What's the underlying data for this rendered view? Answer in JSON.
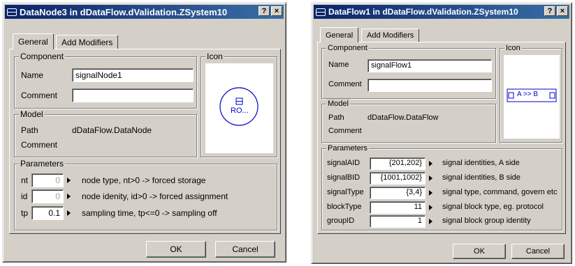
{
  "left": {
    "title": "DataNode3 in dDataFlow.dValidation.ZSystem10",
    "tabs": [
      "General",
      "Add Modifiers"
    ],
    "component": {
      "legend": "Component",
      "name_label": "Name",
      "name_value": "signalNode1",
      "comment_label": "Comment",
      "comment_value": ""
    },
    "icon": {
      "legend": "Icon",
      "text": "RO..."
    },
    "model": {
      "legend": "Model",
      "path_label": "Path",
      "path_value": "dDataFlow.DataNode",
      "comment_label": "Comment"
    },
    "parameters": {
      "legend": "Parameters",
      "rows": [
        {
          "name": "nt",
          "value": "0",
          "desc": "node type, nt>0 -> forced storage"
        },
        {
          "name": "id",
          "value": "0",
          "desc": "node idenity, id>0 -> forced assignment"
        },
        {
          "name": "tp",
          "value": "0.1",
          "desc": "sampling time, tp<=0 -> sampling off"
        }
      ]
    },
    "ok": "OK",
    "cancel": "Cancel"
  },
  "right": {
    "title": "DataFlow1 in dDataFlow.dValidation.ZSystem10",
    "tabs": [
      "General",
      "Add Modifiers"
    ],
    "component": {
      "legend": "Component",
      "name_label": "Name",
      "name_value": "signalFlow1",
      "comment_label": "Comment",
      "comment_value": ""
    },
    "icon": {
      "legend": "Icon",
      "text": "A >> B"
    },
    "model": {
      "legend": "Model",
      "path_label": "Path",
      "path_value": "dDataFlow.DataFlow",
      "comment_label": "Comment"
    },
    "parameters": {
      "legend": "Parameters",
      "rows": [
        {
          "name": "signalAID",
          "value": "{201,202}",
          "desc": "signal identities, A side"
        },
        {
          "name": "signalBID",
          "value": "{1001,1002}",
          "desc": "signal identities, B side"
        },
        {
          "name": "signalType",
          "value": "{3,4}",
          "desc": "signal type, command, govern etc"
        },
        {
          "name": "blockType",
          "value": "11",
          "desc": "signal block type, eg. protocol"
        },
        {
          "name": "groupID",
          "value": "1",
          "desc": "signal block group identity"
        }
      ]
    },
    "ok": "OK",
    "cancel": "Cancel"
  },
  "title_buttons": {
    "help": "?",
    "close": "×"
  }
}
